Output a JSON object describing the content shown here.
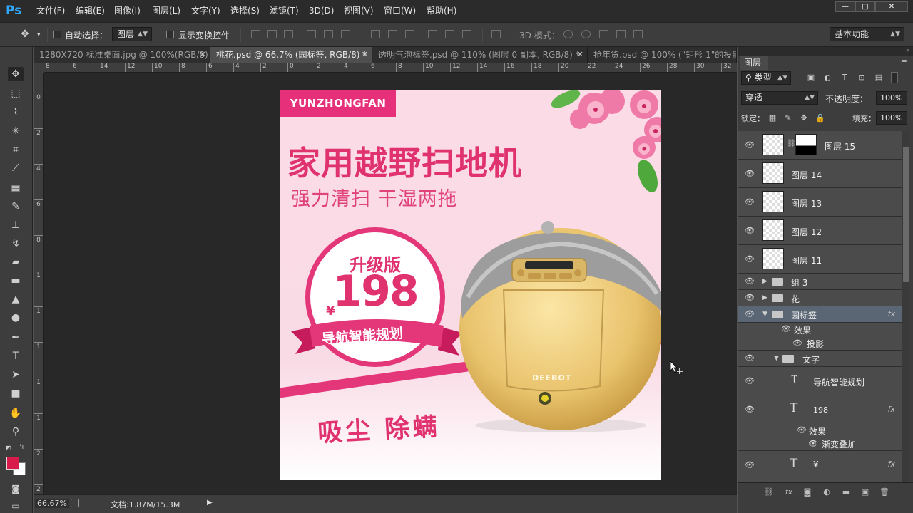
{
  "app": {
    "logo": "Ps",
    "menu": [
      "文件(F)",
      "编辑(E)",
      "图像(I)",
      "图层(L)",
      "文字(Y)",
      "选择(S)",
      "滤镜(T)",
      "3D(D)",
      "视图(V)",
      "窗口(W)",
      "帮助(H)"
    ],
    "window_buttons": {
      "minimize": "—",
      "maximize": "□",
      "close": "✕"
    }
  },
  "options": {
    "auto_select_label": "自动选择：",
    "auto_select_target": "图层",
    "show_transform_label": "显示变换控件",
    "mode_3d_label": "3D 模式：",
    "workspace": "基本功能"
  },
  "tabs": [
    {
      "label": "1280X720 标准桌面.jpg @ 100%(RGB/8)",
      "close": "✕",
      "active": false
    },
    {
      "label": "桃花.psd @ 66.7% (园标签, RGB/8) *",
      "close": "✕",
      "active": true
    },
    {
      "label": "透明气泡标签.psd @ 110% (图层 0 副本, RGB/8) *",
      "close": "✕",
      "active": false
    },
    {
      "label": "抢年货.psd @ 100% (\"矩形 1\"的投影, ...",
      "close": "",
      "active": false
    }
  ],
  "ruler": {
    "h_labels": [
      "8",
      "6",
      "14",
      "12",
      "10",
      "8",
      "6",
      "4",
      "2",
      "0",
      "2",
      "4",
      "6",
      "8",
      "10",
      "12",
      "14",
      "16",
      "18",
      "20",
      "22",
      "24",
      "26",
      "28",
      "30",
      "32"
    ],
    "v_labels": [
      "0",
      "2",
      "4",
      "6",
      "8",
      "1",
      "1",
      "1",
      "1",
      "1",
      "2",
      "2"
    ]
  },
  "artwork": {
    "brand": "YUNZHONGFAN",
    "headline": "家用越野扫地机",
    "subline": "强力清扫  干湿两拖",
    "badge_title": "升级版",
    "currency": "¥",
    "price": "198",
    "ribbon": "导航智能规划",
    "footer": "吸尘  除螨",
    "product_logo": "DEEBOT"
  },
  "status": {
    "zoom": "66.67%",
    "doc": "文档:1.87M/15.3M"
  },
  "layers_panel": {
    "tab": "图层",
    "filter_type": "类型",
    "blend_mode": "穿透",
    "opacity_label": "不透明度：",
    "opacity_value": "100%",
    "lock_label": "锁定：",
    "fill_label": "填充：",
    "fill_value": "100%",
    "layers": [
      {
        "name": "图层 15",
        "kind": "masked"
      },
      {
        "name": "图层 14",
        "kind": "pixel"
      },
      {
        "name": "图层 13",
        "kind": "pixel"
      },
      {
        "name": "图层 12",
        "kind": "pixel"
      },
      {
        "name": "图层 11",
        "kind": "pixel"
      },
      {
        "name": "组 3",
        "kind": "group"
      },
      {
        "name": "花",
        "kind": "group"
      },
      {
        "name": "园标签",
        "kind": "group-open",
        "fx": "fx"
      },
      {
        "name": "效果",
        "kind": "effects"
      },
      {
        "name": "投影",
        "kind": "effect"
      },
      {
        "name": "文字",
        "kind": "group-open"
      },
      {
        "name": "导航智能规划",
        "kind": "warped-text"
      },
      {
        "name": "198",
        "kind": "text",
        "fx": "fx"
      },
      {
        "name": "效果",
        "kind": "effects"
      },
      {
        "name": "渐变叠加",
        "kind": "effect"
      },
      {
        "name": "¥",
        "kind": "text",
        "fx": "fx"
      }
    ]
  },
  "colors": {
    "accent_pink": "#e43779",
    "foreground_swatch": "#d81b4a",
    "background_swatch": "#ffffff"
  }
}
